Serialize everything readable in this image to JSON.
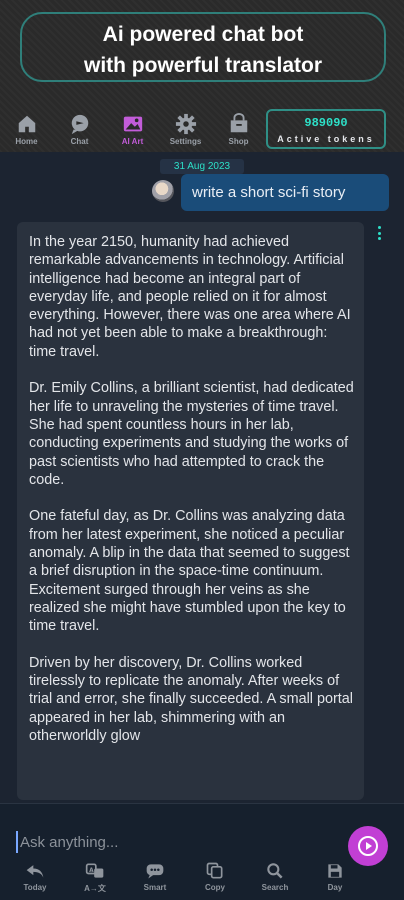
{
  "header": {
    "banner_line1": "Ai powered chat bot",
    "banner_line2": "with powerful translator",
    "nav": [
      {
        "label": "Home",
        "icon": "home-icon"
      },
      {
        "label": "Chat",
        "icon": "chat-icon"
      },
      {
        "label": "AI Art",
        "icon": "image-icon",
        "active": true
      },
      {
        "label": "Settings",
        "icon": "gear-icon"
      },
      {
        "label": "Shop",
        "icon": "shop-icon"
      }
    ],
    "tokens": {
      "count": "989090",
      "label": "Active tokens"
    }
  },
  "chat": {
    "date": "31 Aug 2023",
    "user_message": "write a short sci-fi story",
    "bot_paragraphs": [
      "In the year 2150, humanity had achieved remarkable advancements in technology. Artificial intelligence had become an integral part of everyday life, and people relied on it for almost everything. However, there was one area where AI had not yet been able to make a breakthrough: time travel.",
      "Dr. Emily Collins, a brilliant scientist, had dedicated her life to unraveling the mysteries of time travel. She had spent countless hours in her lab, conducting experiments and studying the works of past scientists who had attempted to crack the code.",
      "One fateful day, as Dr. Collins was analyzing data from her latest experiment, she noticed a peculiar anomaly. A blip in the data that seemed to suggest a brief disruption in the space-time continuum. Excitement surged through her veins as she realized she might have stumbled upon the key to time travel.",
      "Driven by her discovery, Dr. Collins worked tirelessly to replicate the anomaly. After weeks of trial and error, she finally succeeded. A small portal appeared in her lab, shimmering with an otherworldly glow"
    ]
  },
  "input": {
    "placeholder": "Ask anything..."
  },
  "toolbar": [
    {
      "label": "Today",
      "icon": "back-arrow-icon"
    },
    {
      "label": "A→文",
      "icon": "translate-icon"
    },
    {
      "label": "Smart",
      "icon": "smart-chat-icon"
    },
    {
      "label": "Copy",
      "icon": "copy-icon"
    },
    {
      "label": "Search",
      "icon": "search-icon"
    },
    {
      "label": "Day",
      "icon": "day-icon"
    }
  ],
  "colors": {
    "accent": "#c13fd4",
    "teal": "#2de0c8",
    "user_bubble": "#1a4c79"
  }
}
